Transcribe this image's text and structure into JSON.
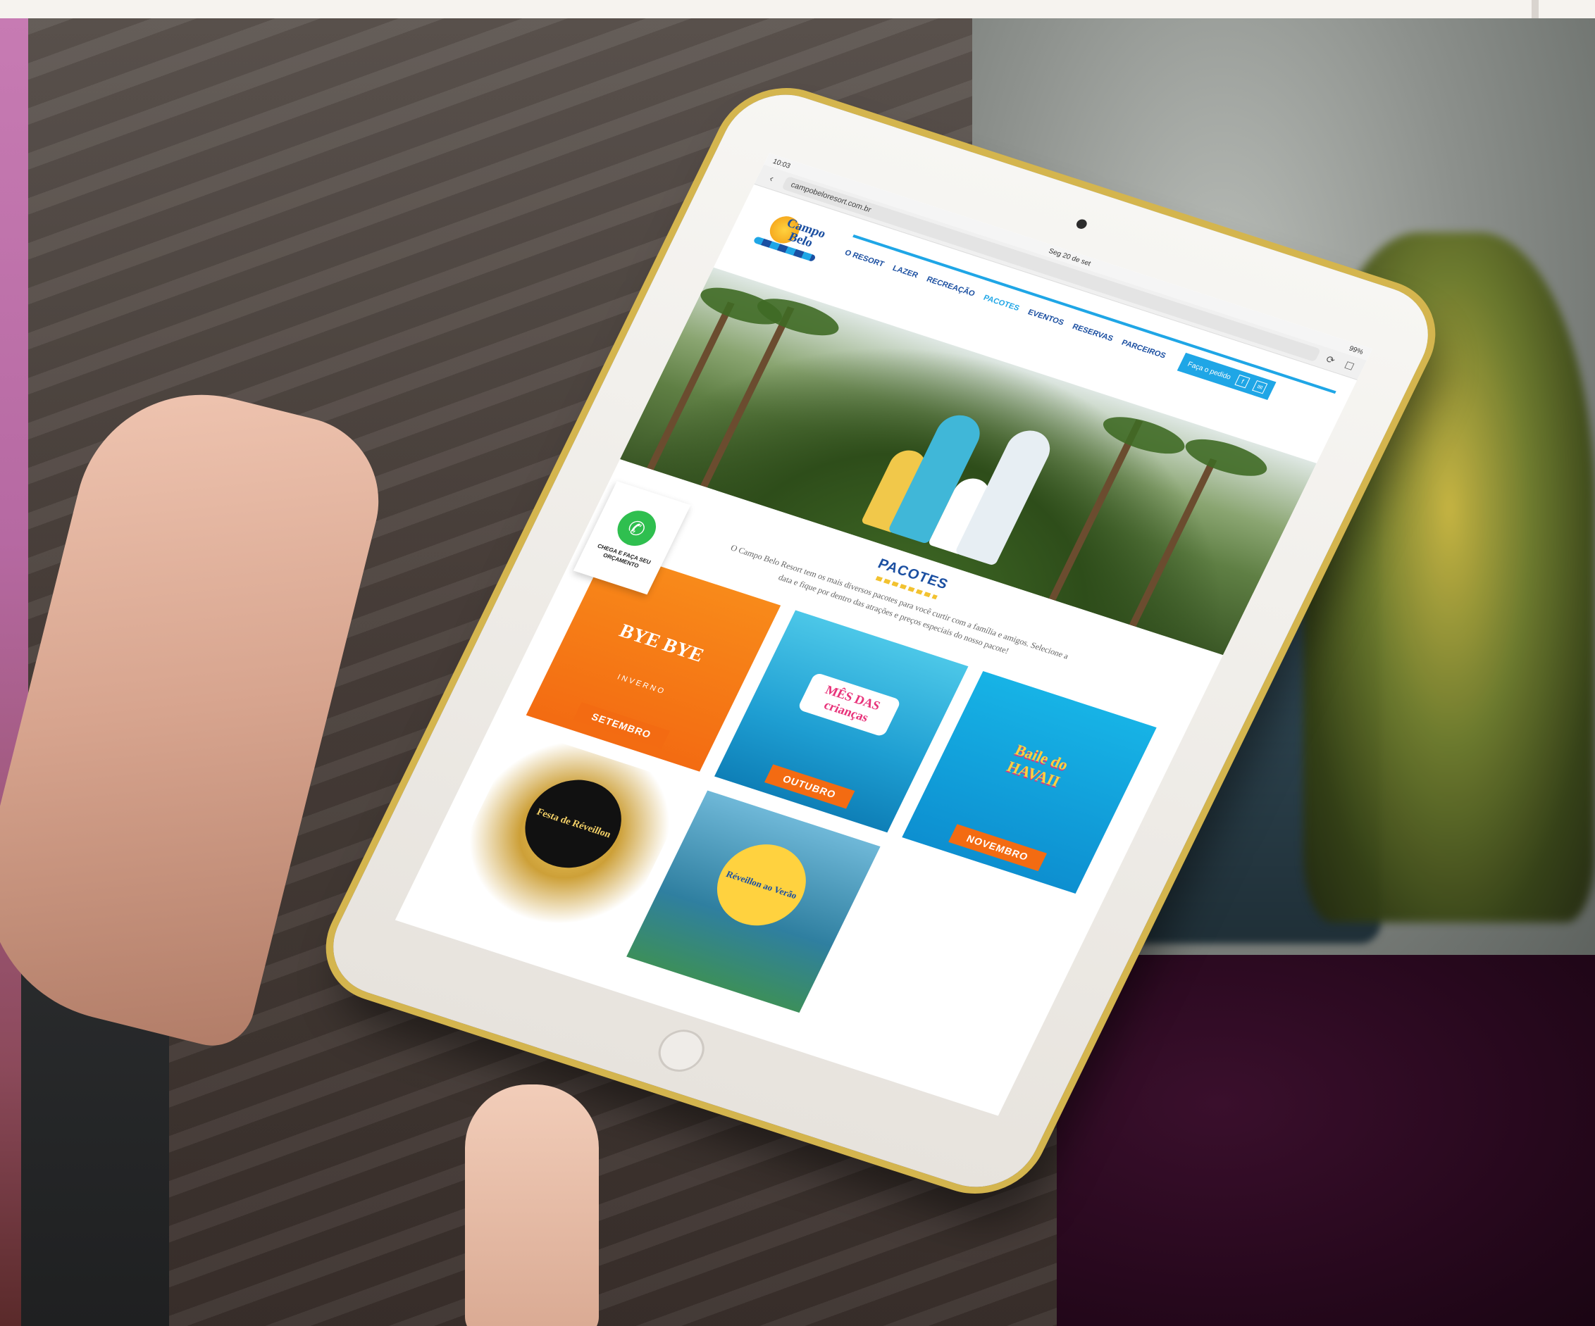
{
  "browser": {
    "status_time": "10:03",
    "status_date": "Seg 20 de set",
    "battery": "99%",
    "url": "campobeloresort.com.br"
  },
  "site": {
    "logo_line1": "Campo",
    "logo_line2": "Belo",
    "nav": [
      "O RESORT",
      "LAZER",
      "RECREAÇÃO",
      "PACOTES",
      "EVENTOS",
      "RESERVAS",
      "PARCEIROS"
    ],
    "active_nav": "PACOTES",
    "cta_label": "Faça o pedido"
  },
  "section": {
    "title": "PACOTES",
    "description": "O Campo Belo Resort tem os mais diversos pacotes para você curtir com a família e amigos. Selecione a data e fique por dentro das atrações e preços especiais do nosso pacote!"
  },
  "whatsapp": {
    "label": "CHEGA E FAÇA SEU ORÇAMENTO"
  },
  "packages": [
    {
      "title": "BYE BYE",
      "subtitle": "INVERNO",
      "label": "SETEMBRO"
    },
    {
      "title": "MÊS DAS crianças",
      "label": "OUTUBRO"
    },
    {
      "title": "Baile do HAVAII",
      "label": "NOVEMBRO"
    },
    {
      "title": "Festa de Réveillon",
      "label": ""
    },
    {
      "title": "Réveillon ao Verão",
      "label": ""
    }
  ],
  "colors": {
    "brand_blue": "#1b4fa1",
    "accent_blue": "#1fa6e6",
    "orange": "#f36b12",
    "whatsapp_green": "#2fbf4f"
  }
}
